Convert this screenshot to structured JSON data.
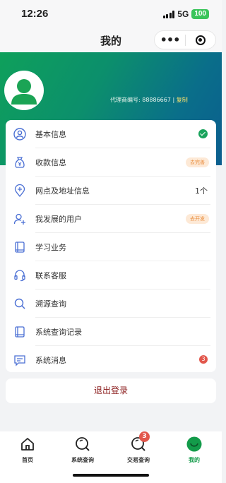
{
  "status": {
    "time": "12:26",
    "network": "5G",
    "battery": "100"
  },
  "navbar": {
    "title": "我的",
    "more_icon": "ellipsis-icon",
    "close_icon": "target-icon"
  },
  "profile": {
    "agent_label": "代理商编号: 88886667",
    "separator": "|",
    "copy_label": "复制"
  },
  "menu": [
    {
      "label": "基本信息",
      "icon": "user-circle-icon",
      "status_type": "check"
    },
    {
      "label": "收款信息",
      "icon": "money-bag-icon",
      "status_type": "tag",
      "status_text": "去完善"
    },
    {
      "label": "网点及地址信息",
      "icon": "location-plus-icon",
      "status_type": "count",
      "status_text": "1个"
    },
    {
      "label": "我发展的用户",
      "icon": "user-add-icon",
      "status_type": "tag",
      "status_text": "去开发"
    },
    {
      "label": "学习业务",
      "icon": "book-icon"
    },
    {
      "label": "联系客服",
      "icon": "headset-icon"
    },
    {
      "label": "溯源查询",
      "icon": "search-icon"
    },
    {
      "label": "系统查询记录",
      "icon": "book-record-icon"
    },
    {
      "label": "系统消息",
      "icon": "message-icon",
      "status_type": "badge",
      "status_text": "3"
    }
  ],
  "logout_label": "退出登录",
  "tabs": [
    {
      "label": "首页",
      "icon": "home-icon"
    },
    {
      "label": "系统查询",
      "icon": "magnifier-icon"
    },
    {
      "label": "交易查询",
      "icon": "magnifier-icon",
      "badge": "3"
    },
    {
      "label": "我的",
      "icon": "profile-smile-icon",
      "active": true
    }
  ],
  "colors": {
    "accent": "#139b4a",
    "header_start": "#0ea05b",
    "header_end": "#0b5e8f",
    "icon_blue": "#4a6fd4",
    "logout_text": "#8b1d1d"
  }
}
